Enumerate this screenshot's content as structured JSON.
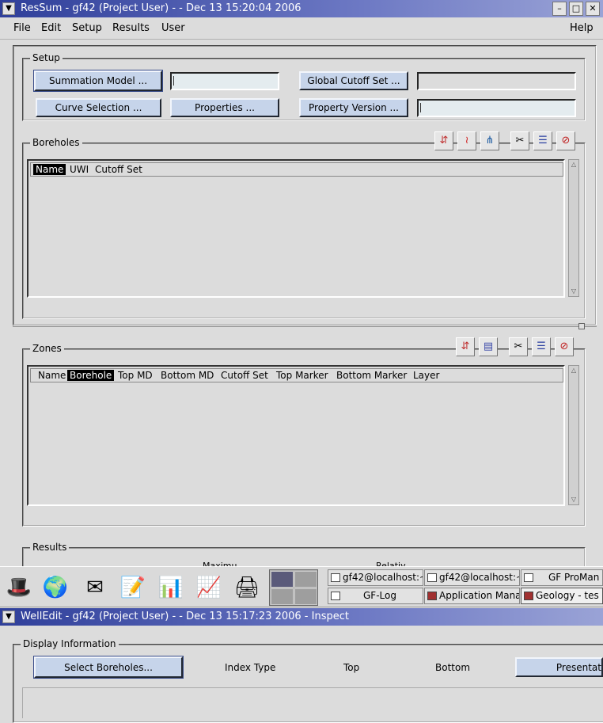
{
  "window1": {
    "title": "ResSum - gf42  (Project User) - - Dec 13 15:20:04 2006",
    "menu": [
      "File",
      "Edit",
      "Setup",
      "Results",
      "User"
    ],
    "help": "Help",
    "setup": {
      "label": "Setup",
      "summation_model": "Summation Model ...",
      "global_cutoff": "Global Cutoff  Set ...",
      "curve_selection": "Curve Selection ...",
      "properties": "Properties ...",
      "property_version": "Property Version ..."
    },
    "boreholes": {
      "label": "Boreholes",
      "columns": [
        "Name",
        "UWI",
        "Cutoff Set"
      ],
      "selected_column": "Name"
    },
    "zones": {
      "label": "Zones",
      "columns": [
        "Name",
        "Borehole",
        "Top MD",
        "Bottom MD",
        "Cutoff Set",
        "Top Marker",
        "Bottom Marker",
        "Layer"
      ],
      "selected_column": "Borehole"
    },
    "results": {
      "label": "Results",
      "partial_labels": [
        "Maximu",
        "Relativ"
      ]
    }
  },
  "taskbar": {
    "tasks": [
      {
        "label": "gf42@localhost:~"
      },
      {
        "label": "gf42@localhost:~"
      },
      {
        "label": "GF ProMan"
      },
      {
        "label": "GF-Log"
      },
      {
        "label": "Application Mana"
      },
      {
        "label": "Geology  - tes"
      }
    ]
  },
  "window2": {
    "title": "WellEdit - gf42  (Project User) - - Dec 13 15:17:23 2006 - Inspect",
    "display_info": {
      "label": "Display Information",
      "select_boreholes": "Select Boreholes...",
      "index_type": "Index Type",
      "top": "Top",
      "bottom": "Bottom",
      "presentation": "Presentat"
    }
  },
  "colors": {
    "titlebar": "#2f3f9a",
    "button": "#c6d4ea",
    "background": "#dcdcdc"
  }
}
